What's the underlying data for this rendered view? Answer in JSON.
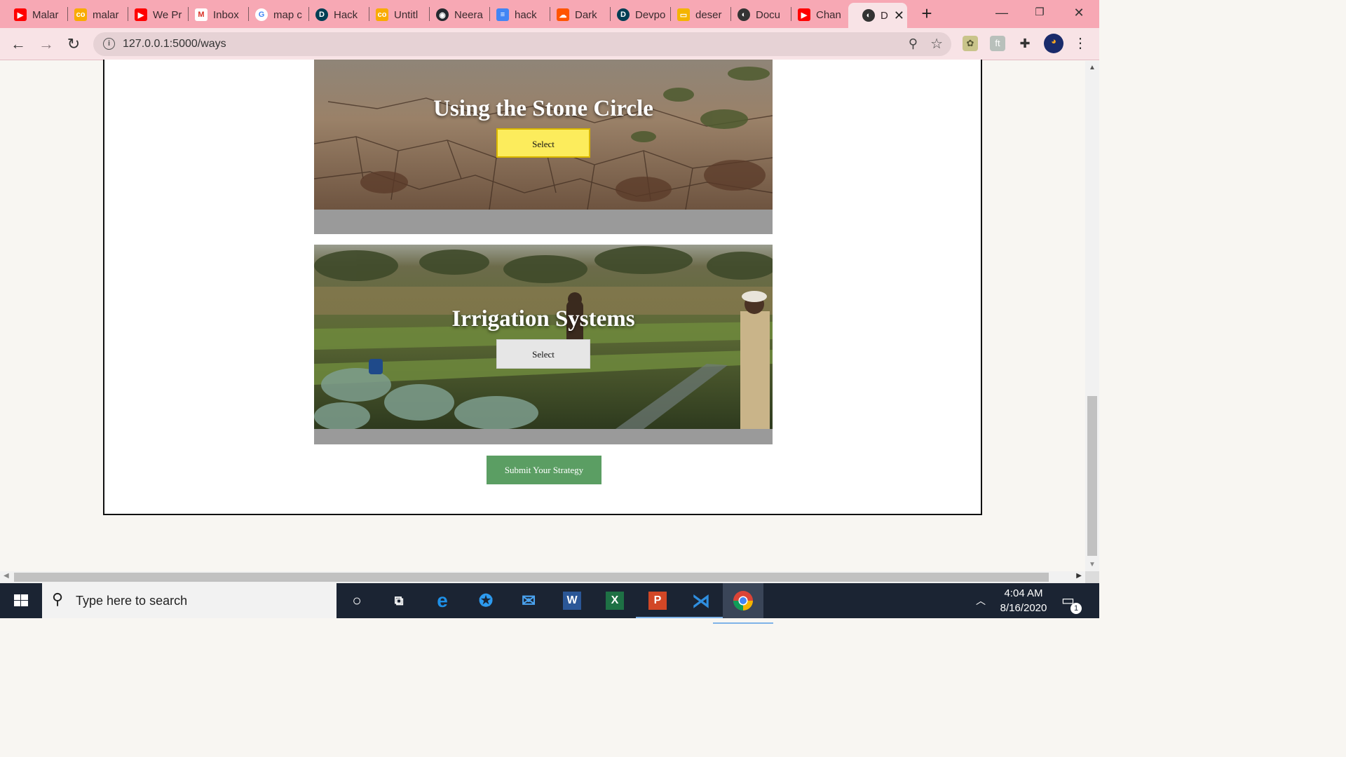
{
  "browser": {
    "tabs": [
      {
        "label": "Malar",
        "icon": "youtube-icon",
        "color": "#ff0000"
      },
      {
        "label": "malar",
        "icon": "colab-icon",
        "color": "#f9ab00"
      },
      {
        "label": "We Pr",
        "icon": "youtube-icon",
        "color": "#ff0000"
      },
      {
        "label": "Inbox",
        "icon": "gmail-icon",
        "color": "#d93025"
      },
      {
        "label": "map c",
        "icon": "google-icon",
        "color": "#4285f4"
      },
      {
        "label": "Hack",
        "icon": "devpost-icon",
        "color": "#003e54"
      },
      {
        "label": "Untitl",
        "icon": "colab-icon",
        "color": "#f9ab00"
      },
      {
        "label": "Neera",
        "icon": "github-icon",
        "color": "#24292e"
      },
      {
        "label": "hack",
        "icon": "docs-icon",
        "color": "#4285f4"
      },
      {
        "label": "Dark",
        "icon": "soundcloud-icon",
        "color": "#ff5500"
      },
      {
        "label": "Devpo",
        "icon": "devpost-icon",
        "color": "#003e54"
      },
      {
        "label": "deser",
        "icon": "slides-icon",
        "color": "#f4b400"
      },
      {
        "label": "Docu",
        "icon": "globe-icon",
        "color": "#333333"
      },
      {
        "label": "Chan",
        "icon": "youtube-icon",
        "color": "#ff0000"
      },
      {
        "label": "D",
        "icon": "globe-icon",
        "color": "#333333"
      }
    ],
    "url": "127.0.0.1:5000/ways"
  },
  "page": {
    "cards": [
      {
        "title": "Using the Stone Circle",
        "select_label": "Select",
        "selected": true
      },
      {
        "title": "Irrigation Systems",
        "select_label": "Select",
        "selected": false
      }
    ],
    "submit_label": "Submit Your Strategy",
    "colors": {
      "selected": "#fcec5c",
      "submit": "#5b9e63",
      "card_footer": "#9a9a9a"
    }
  },
  "taskbar": {
    "search_placeholder": "Type here to search",
    "time": "4:04 AM",
    "date": "8/16/2020",
    "notifications": "1"
  }
}
